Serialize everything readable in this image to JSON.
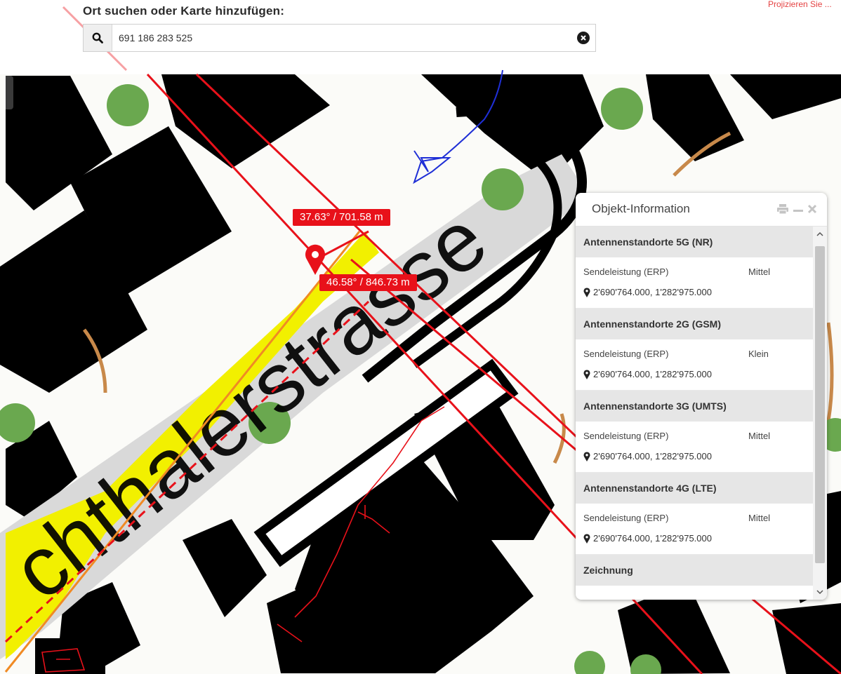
{
  "search": {
    "title": "Ort suchen oder Karte hinzufügen:",
    "value": "691 186 283 525"
  },
  "top_right_text": "Projizieren Sie ...",
  "map": {
    "street_label": "chthalerstrasse",
    "measurements": [
      {
        "text": "37.63° / 701.58 m"
      },
      {
        "text": "46.58° / 846.73 m"
      }
    ],
    "colors": {
      "measure_line": "#e8111a",
      "street_highlight": "#f2f000",
      "path_orange": "#f08a24",
      "tree": "#6aa84f",
      "building": "#000000",
      "blue_sketch": "#1f2fd6"
    }
  },
  "info_panel": {
    "title": "Objekt-Information",
    "tools": [
      "print-icon",
      "minimize-icon",
      "close-icon"
    ],
    "sections": [
      {
        "title": "Antennenstandorte 5G (NR)",
        "attr_label": "Sendeleistung (ERP)",
        "attr_value": "Mittel",
        "coords": "2'690'764.000, 1'282'975.000"
      },
      {
        "title": "Antennenstandorte 2G (GSM)",
        "attr_label": "Sendeleistung (ERP)",
        "attr_value": "Klein",
        "coords": "2'690'764.000, 1'282'975.000"
      },
      {
        "title": "Antennenstandorte 3G (UMTS)",
        "attr_label": "Sendeleistung (ERP)",
        "attr_value": "Mittel",
        "coords": "2'690'764.000, 1'282'975.000"
      },
      {
        "title": "Antennenstandorte 4G (LTE)",
        "attr_label": "Sendeleistung (ERP)",
        "attr_value": "Mittel",
        "coords": "2'690'764.000, 1'282'975.000"
      },
      {
        "title": "Zeichnung"
      }
    ]
  }
}
